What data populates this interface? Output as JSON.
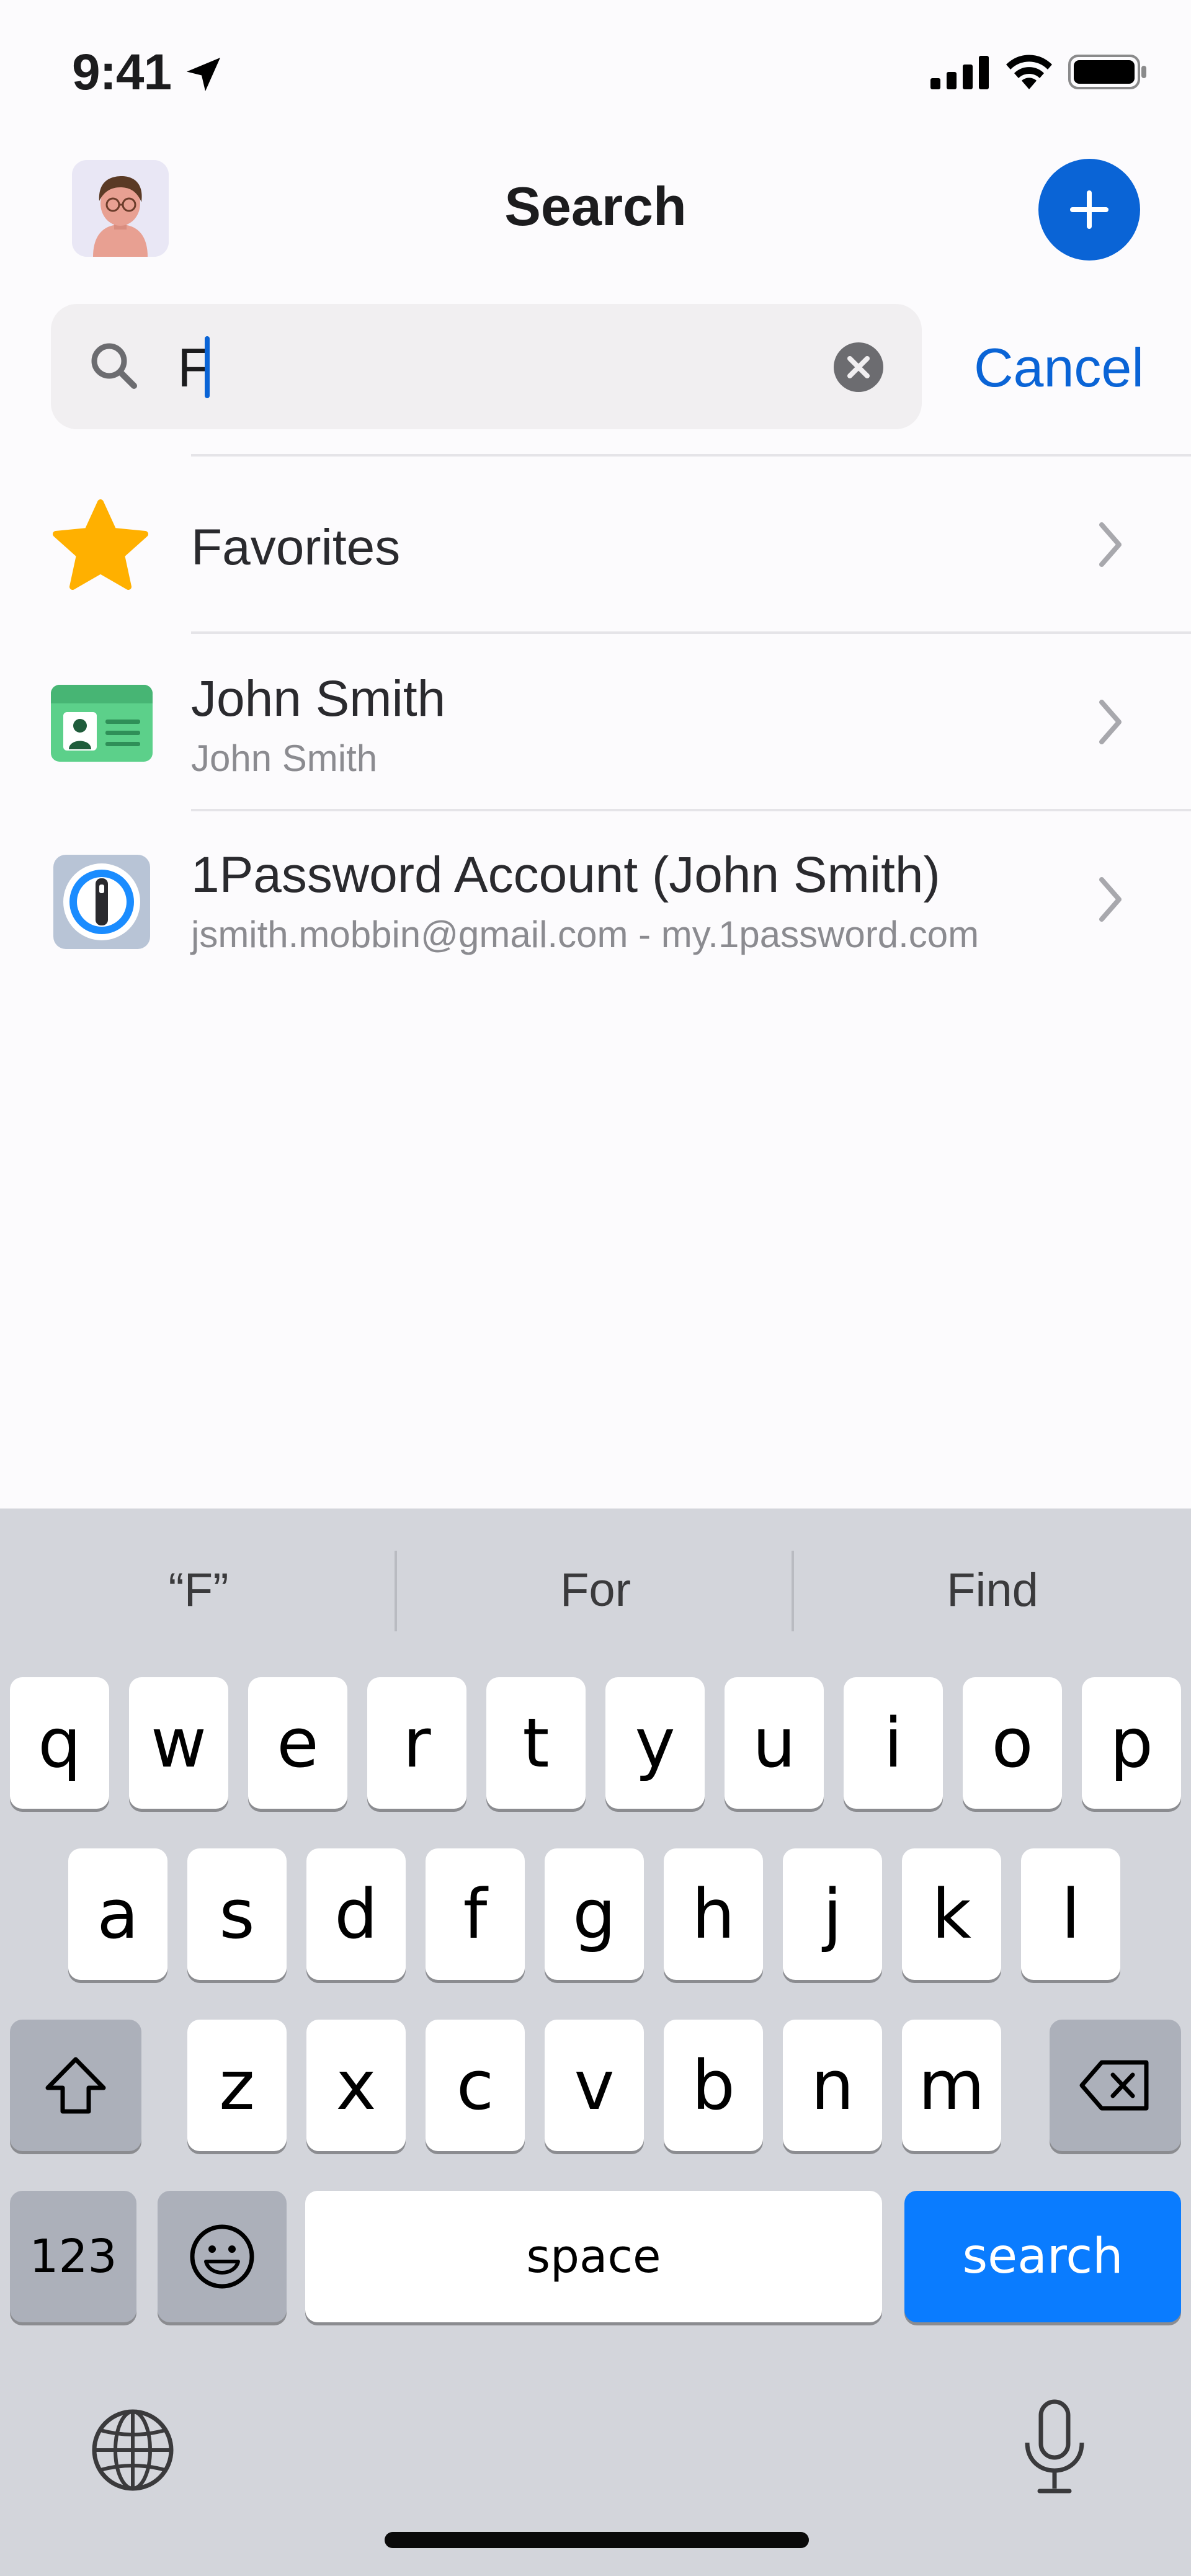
{
  "status_bar": {
    "time": "9:41"
  },
  "header": {
    "title": "Search"
  },
  "search": {
    "value": "F",
    "cancel_label": "Cancel"
  },
  "results": [
    {
      "title": "Favorites",
      "subtitle": ""
    },
    {
      "title": "John Smith",
      "subtitle": "John Smith"
    },
    {
      "title": "1Password Account (John Smith)",
      "subtitle": "jsmith.mobbin@gmail.com - my.1password.com"
    }
  ],
  "keyboard": {
    "suggestions": [
      "“F”",
      "For",
      "Find"
    ],
    "row1": [
      "q",
      "w",
      "e",
      "r",
      "t",
      "y",
      "u",
      "i",
      "o",
      "p"
    ],
    "row2": [
      "a",
      "s",
      "d",
      "f",
      "g",
      "h",
      "j",
      "k",
      "l"
    ],
    "row3": [
      "z",
      "x",
      "c",
      "v",
      "b",
      "n",
      "m"
    ],
    "numbers_label": "123",
    "space_label": "space",
    "search_label": "search"
  },
  "colors": {
    "accent": "#0a64d6",
    "keyboard_bg": "#d3d5db",
    "search_key": "#0a7cff",
    "star": "#ffb000"
  },
  "icons": [
    "location-arrow-icon",
    "signal-icon",
    "wifi-icon",
    "battery-icon",
    "plus-icon",
    "search-icon",
    "clear-icon",
    "star-icon",
    "identity-icon",
    "1password-icon",
    "chevron-right-icon",
    "shift-icon",
    "backspace-icon",
    "emoji-icon",
    "globe-icon",
    "microphone-icon"
  ]
}
